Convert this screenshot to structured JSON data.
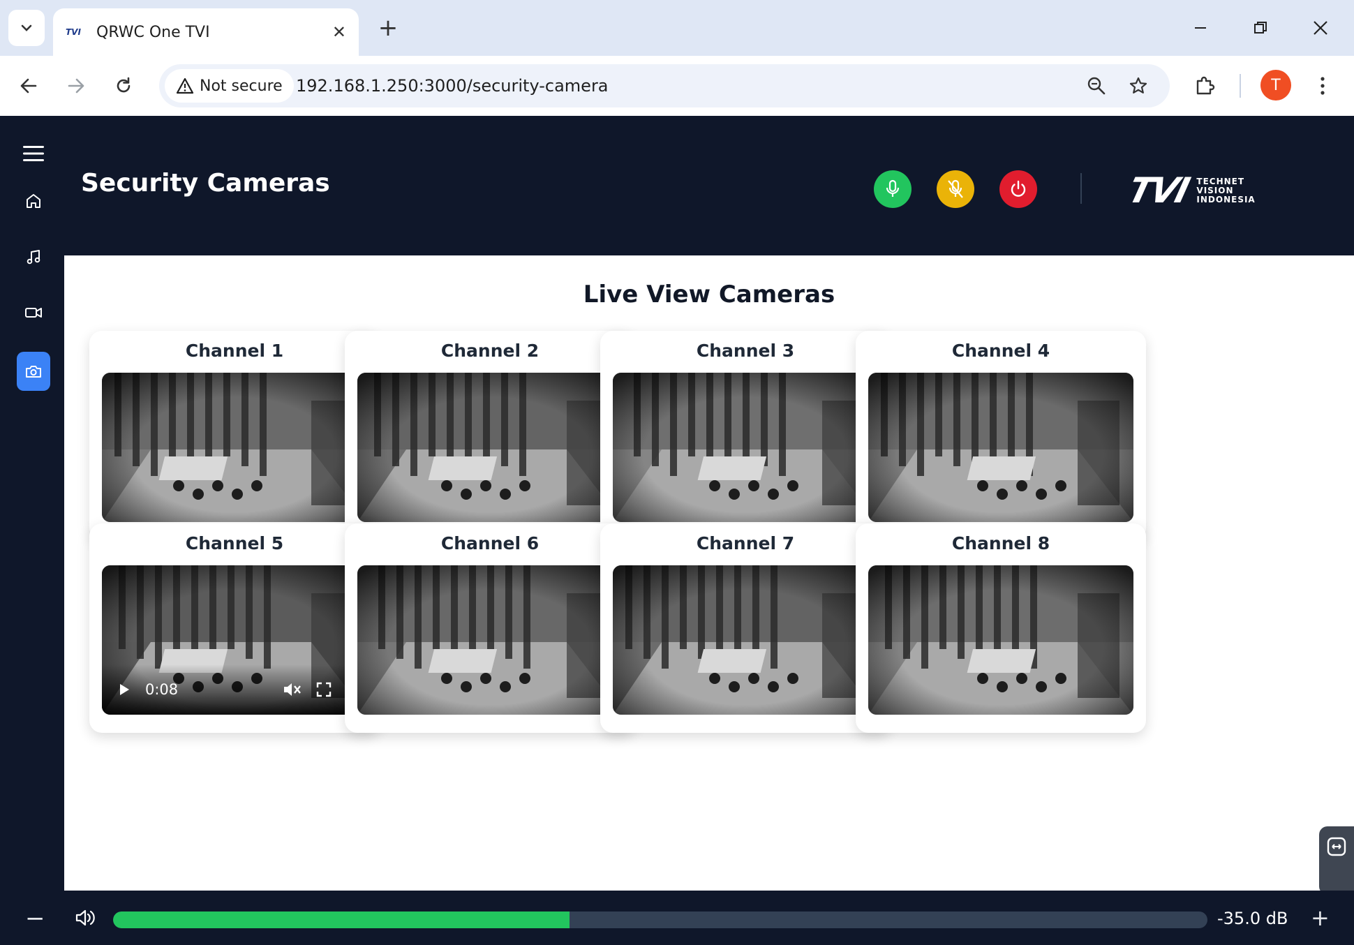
{
  "browser": {
    "tab_title": "QRWC One TVI",
    "tab_favicon_text": "TVI",
    "security_label": "Not secure",
    "url": "192.168.1.250:3000/security-camera",
    "profile_initial": "T"
  },
  "header": {
    "title": "Security Cameras",
    "buttons": [
      {
        "name": "microphone-on",
        "color": "#22c55e"
      },
      {
        "name": "microphone-muted",
        "color": "#eab308"
      },
      {
        "name": "power",
        "color": "#e11d2e"
      }
    ],
    "logo": {
      "mark": "TVI",
      "line1": "TECHNET",
      "line2": "VISION",
      "line3": "INDONESIA"
    }
  },
  "sidebar": {
    "items": [
      {
        "icon": "menu-icon",
        "active": false
      },
      {
        "icon": "home-icon",
        "active": false
      },
      {
        "icon": "music-icon",
        "active": false
      },
      {
        "icon": "video-icon",
        "active": false
      },
      {
        "icon": "camera-icon",
        "active": true
      }
    ]
  },
  "main": {
    "title": "Live View Cameras",
    "channels": [
      {
        "label": "Channel 1"
      },
      {
        "label": "Channel 2"
      },
      {
        "label": "Channel 3"
      },
      {
        "label": "Channel 4"
      },
      {
        "label": "Channel 5",
        "player": {
          "time": "0:08",
          "muted": true
        }
      },
      {
        "label": "Channel 6"
      },
      {
        "label": "Channel 7"
      },
      {
        "label": "Channel 8"
      }
    ]
  },
  "footer": {
    "volume_readout": "-35.0 dB",
    "volume_fraction": 0.417,
    "accent": "#22c55e"
  }
}
